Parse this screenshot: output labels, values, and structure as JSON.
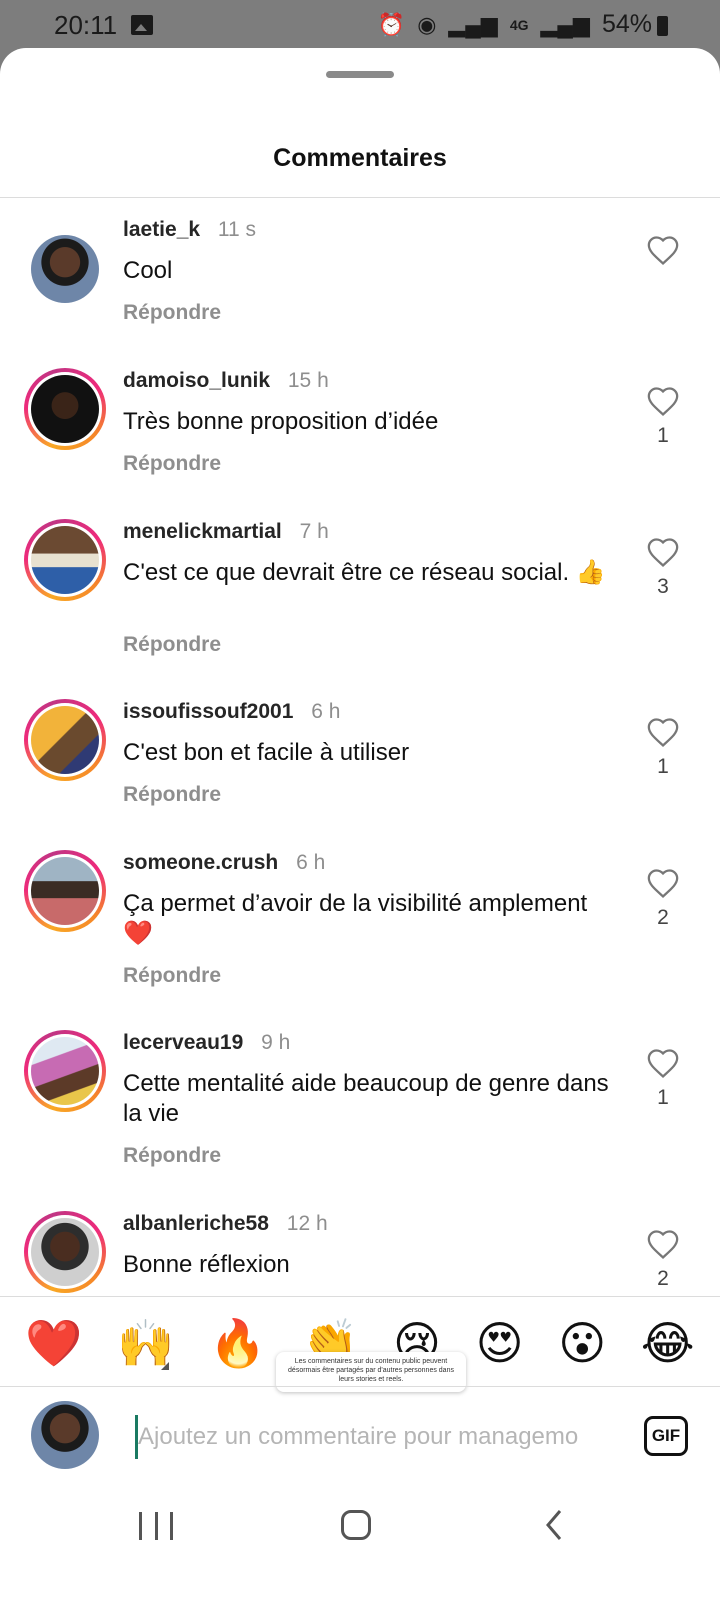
{
  "status_bar": {
    "time": "20:11",
    "battery": "54%",
    "network": "4G"
  },
  "sheet": {
    "title": "Commentaires"
  },
  "comments": [
    {
      "username": "laetie_k",
      "time": "11 s",
      "text": "Cool",
      "reply_label": "Répondre",
      "likes": "",
      "story_ring": false
    },
    {
      "username": "damoiso_lunik",
      "time": "15 h",
      "text": "Très bonne proposition d’idée",
      "reply_label": "Répondre",
      "likes": "1",
      "story_ring": true
    },
    {
      "username": "menelickmartial",
      "time": "7 h",
      "text": "C'est ce que devrait être ce réseau social. 👍",
      "reply_label": "Répondre",
      "likes": "3",
      "story_ring": true
    },
    {
      "username": "issoufissouf2001",
      "time": "6 h",
      "text": "C'est bon et facile à utiliser",
      "reply_label": "Répondre",
      "likes": "1",
      "story_ring": true
    },
    {
      "username": "someone.crush",
      "time": "6 h",
      "text": "Ça permet d’avoir de la visibilité amplement ❤️",
      "reply_label": "Répondre",
      "likes": "2",
      "story_ring": true
    },
    {
      "username": "lecerveau19",
      "time": "9 h",
      "text": "Cette mentalité aide beaucoup de genre dans la vie",
      "reply_label": "Répondre",
      "likes": "1",
      "story_ring": true
    },
    {
      "username": "albanleriche58",
      "time": "12 h",
      "text": "Bonne réflexion",
      "reply_label": "",
      "likes": "2",
      "story_ring": true
    }
  ],
  "emoji_bar": {
    "emojis": [
      "❤️",
      "🙌",
      "🔥",
      "👏",
      "😢",
      "😍",
      "😮",
      "😂"
    ],
    "tooltip": "Les commentaires sur du contenu public peuvent désormais être partagés par d'autres personnes dans leurs stories et reels."
  },
  "composer": {
    "placeholder": "Ajoutez un commentaire pour managemo",
    "gif_label": "GIF"
  },
  "colors": {
    "story_ring": "#ee2a7b",
    "muted_text": "#8e8e8e",
    "cursor": "#1a7a62"
  }
}
